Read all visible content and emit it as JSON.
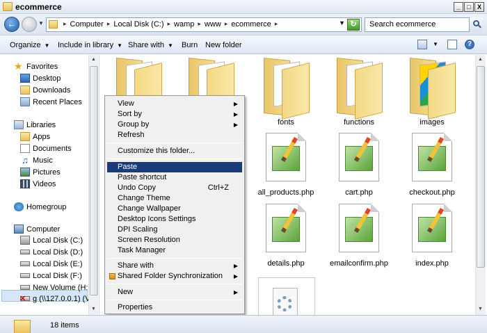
{
  "window": {
    "title": "ecommerce",
    "buttons": {
      "minimize": "_",
      "maximize": "□",
      "close": "X"
    }
  },
  "address": {
    "crumbs": [
      "Computer",
      "Local Disk (C:)",
      "wamp",
      "www",
      "ecommerce"
    ],
    "search_placeholder": "Search ecommerce"
  },
  "toolbar": {
    "organize": "Organize",
    "include_in_library": "Include in library",
    "share_with": "Share with",
    "burn": "Burn",
    "new_folder": "New folder"
  },
  "navpane": {
    "favorites": "Favorites",
    "desktop": "Desktop",
    "downloads": "Downloads",
    "recent_places": "Recent Places",
    "libraries": "Libraries",
    "apps": "Apps",
    "documents": "Documents",
    "music": "Music",
    "pictures": "Pictures",
    "videos": "Videos",
    "homegroup": "Homegroup",
    "computer": "Computer",
    "drives": [
      "Local Disk (C:)",
      "Local Disk (D:)",
      "Local Disk (E:)",
      "Local Disk (F:)",
      "New Volume (H:)",
      "g (\\\\127.0.0.1) (V:"
    ]
  },
  "content": {
    "folders": [
      "fonts",
      "functions",
      "images"
    ],
    "files": [
      "all_products.php",
      "cart.php",
      "checkout.php",
      "details.php",
      "emailconfirm.php",
      "index.php"
    ]
  },
  "context_menu": {
    "view": "View",
    "sort_by": "Sort by",
    "group_by": "Group by",
    "refresh": "Refresh",
    "customize": "Customize this folder...",
    "paste": "Paste",
    "paste_shortcut": "Paste shortcut",
    "undo_copy": "Undo Copy",
    "undo_shortcut": "Ctrl+Z",
    "change_theme": "Change Theme",
    "change_wallpaper": "Change Wallpaper",
    "desktop_icons_settings": "Desktop Icons Settings",
    "dpi_scaling": "DPI Scaling",
    "screen_resolution": "Screen Resolution",
    "task_manager": "Task Manager",
    "share_with": "Share with",
    "shared_folder_sync": "Shared Folder Synchronization",
    "new": "New",
    "properties": "Properties"
  },
  "status": {
    "item_count": "18 items"
  }
}
